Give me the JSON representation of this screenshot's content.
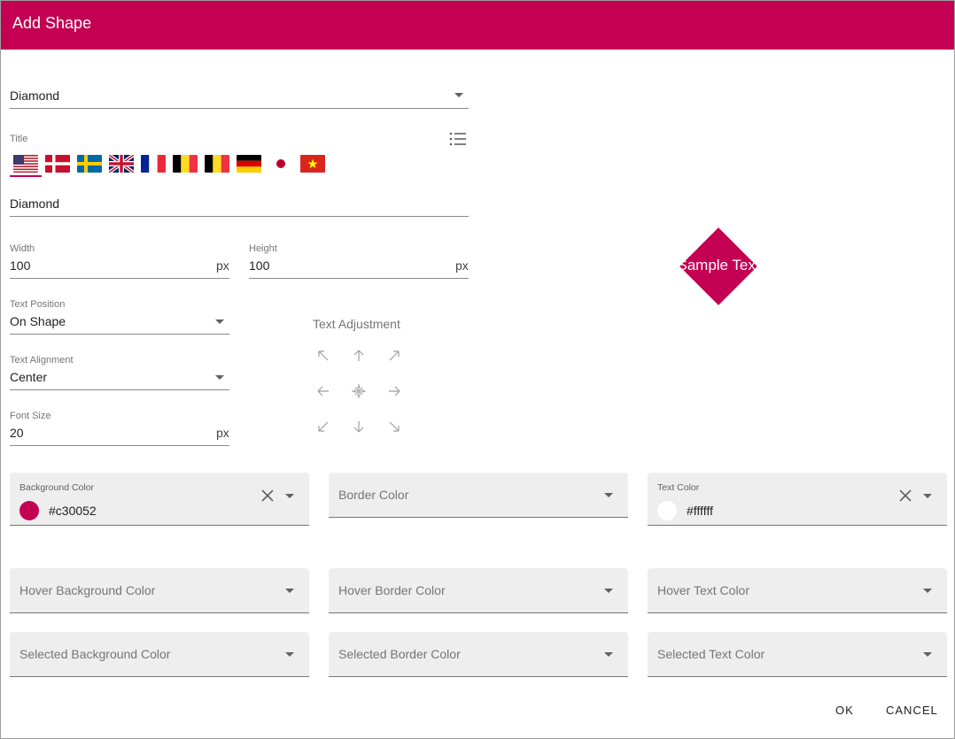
{
  "dialog": {
    "title": "Add Shape"
  },
  "shape_select": {
    "value": "Diamond"
  },
  "title_field": {
    "label": "Title",
    "list_icon": "list-icon",
    "languages": [
      "en-US",
      "da",
      "sv",
      "en-GB",
      "fr",
      "be",
      "be-2",
      "de",
      "ja",
      "vi"
    ],
    "selected_language": "en-US",
    "value": "Diamond"
  },
  "width": {
    "label": "Width",
    "value": "100",
    "unit": "px"
  },
  "height": {
    "label": "Height",
    "value": "100",
    "unit": "px"
  },
  "text_position": {
    "label": "Text Position",
    "value": "On Shape"
  },
  "text_alignment": {
    "label": "Text Alignment",
    "value": "Center"
  },
  "font_size": {
    "label": "Font Size",
    "value": "20",
    "unit": "px"
  },
  "text_adjustment": {
    "label": "Text Adjustment",
    "icons": [
      "arrow-up-left-icon",
      "arrow-up-icon",
      "arrow-up-right-icon",
      "arrow-left-icon",
      "center-icon",
      "arrow-right-icon",
      "arrow-down-left-icon",
      "arrow-down-icon",
      "arrow-down-right-icon"
    ]
  },
  "preview": {
    "text": "Sample Text",
    "shape_color": "#c30052",
    "text_color": "#ffffff"
  },
  "colors": {
    "background": {
      "label": "Background Color",
      "value": "#c30052",
      "swatch": "#c30052"
    },
    "border": {
      "label": "Border Color"
    },
    "text": {
      "label": "Text Color",
      "value": "#ffffff",
      "swatch": "#ffffff"
    },
    "hover_background": {
      "label": "Hover Background Color"
    },
    "hover_border": {
      "label": "Hover Border Color"
    },
    "hover_text": {
      "label": "Hover Text Color"
    },
    "selected_background": {
      "label": "Selected Background Color"
    },
    "selected_border": {
      "label": "Selected Border Color"
    },
    "selected_text": {
      "label": "Selected Text Color"
    }
  },
  "buttons": {
    "ok": "OK",
    "cancel": "CANCEL"
  },
  "theme": {
    "accent": "#c30052"
  }
}
